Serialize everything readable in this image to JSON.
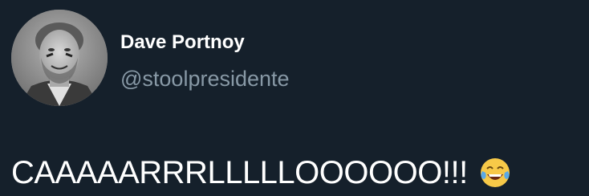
{
  "tweet": {
    "author": {
      "display_name": "Dave Portnoy",
      "handle": "@stoolpresidente",
      "avatar_icon": "profile-photo"
    },
    "text": "CAAAAARRRLLLLLOOOOOO!!!",
    "emoji_icon": "face-with-tears-of-joy-icon"
  },
  "colors": {
    "background": "#15202b",
    "name": "#ffffff",
    "handle": "#8899a6",
    "text": "#ffffff"
  }
}
